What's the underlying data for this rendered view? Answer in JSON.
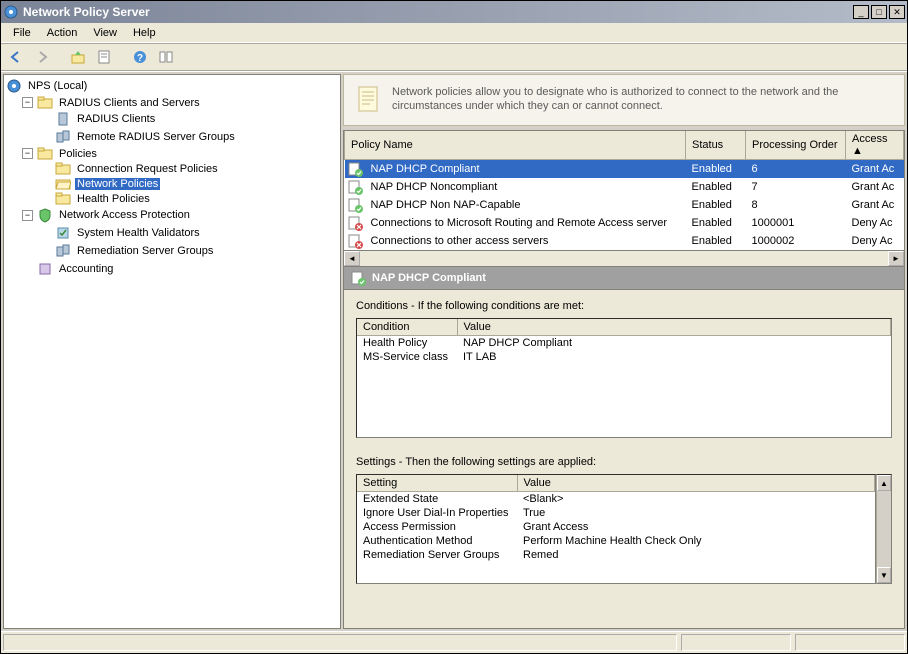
{
  "window": {
    "title": "Network Policy Server"
  },
  "menubar": {
    "file": "File",
    "action": "Action",
    "view": "View",
    "help": "Help"
  },
  "tree": {
    "root": "NPS (Local)",
    "radius_parent": "RADIUS Clients and Servers",
    "radius_clients": "RADIUS Clients",
    "remote_radius": "Remote RADIUS Server Groups",
    "policies": "Policies",
    "conn_req": "Connection Request Policies",
    "network_policies": "Network Policies",
    "health_policies": "Health Policies",
    "nap": "Network Access Protection",
    "shv": "System Health Validators",
    "rsg": "Remediation Server Groups",
    "accounting": "Accounting"
  },
  "banner": {
    "text": "Network policies allow you to designate who is authorized to connect to the network and the circumstances under which they can or cannot connect."
  },
  "table": {
    "h1": "Policy Name",
    "h2": "Status",
    "h3": "Processing Order",
    "h4": "Access ",
    "rows": [
      {
        "name": "NAP DHCP Compliant",
        "status": "Enabled",
        "order": "6",
        "access": "Grant Ac",
        "icon": "green"
      },
      {
        "name": "NAP DHCP Noncompliant",
        "status": "Enabled",
        "order": "7",
        "access": "Grant Ac",
        "icon": "green"
      },
      {
        "name": "NAP DHCP Non NAP-Capable",
        "status": "Enabled",
        "order": "8",
        "access": "Grant Ac",
        "icon": "green"
      },
      {
        "name": "Connections to Microsoft Routing and Remote Access server",
        "status": "Enabled",
        "order": "1000001",
        "access": "Deny Ac",
        "icon": "red"
      },
      {
        "name": "Connections to other access servers",
        "status": "Enabled",
        "order": "1000002",
        "access": "Deny Ac",
        "icon": "red"
      }
    ]
  },
  "detail": {
    "title": "NAP DHCP Compliant",
    "conditions_label": "Conditions - If the following conditions are met:",
    "cond_h1": "Condition",
    "cond_h2": "Value",
    "conditions": [
      {
        "c": "Health Policy",
        "v": "NAP DHCP Compliant"
      },
      {
        "c": "MS-Service class",
        "v": "IT LAB"
      }
    ],
    "settings_label": "Settings - Then the following settings are applied:",
    "set_h1": "Setting",
    "set_h2": "Value",
    "settings": [
      {
        "s": "Extended State",
        "v": "<Blank>"
      },
      {
        "s": "Ignore User Dial-In Properties",
        "v": "True"
      },
      {
        "s": "Access Permission",
        "v": "Grant Access"
      },
      {
        "s": "Authentication Method",
        "v": "Perform Machine Health Check Only"
      },
      {
        "s": "Remediation Server Groups",
        "v": "Remed"
      }
    ]
  }
}
